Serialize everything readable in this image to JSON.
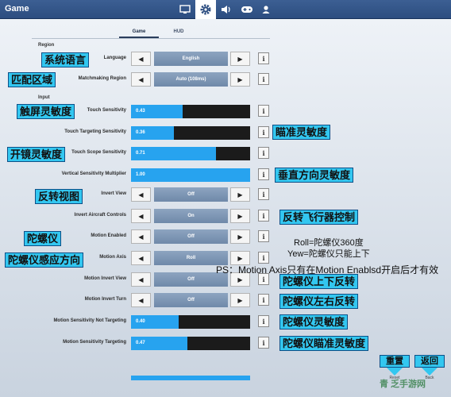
{
  "header": {
    "title": "Game",
    "icons": [
      {
        "name": "display-icon",
        "active": false
      },
      {
        "name": "gear-icon",
        "active": true
      },
      {
        "name": "speaker-icon",
        "active": false
      },
      {
        "name": "gamepad-icon",
        "active": false
      },
      {
        "name": "user-icon",
        "active": false
      }
    ]
  },
  "subtabs": [
    {
      "label": "Game",
      "active": true
    },
    {
      "label": "HUD",
      "active": false
    }
  ],
  "sections": {
    "region": "Region",
    "input": "Input"
  },
  "settings": [
    {
      "label": "Language",
      "type": "option",
      "value": "English"
    },
    {
      "label": "Matchmaking Region",
      "type": "option",
      "value": "Auto (108ms)"
    },
    {
      "label": "Touch Sensitivity",
      "type": "slider",
      "value": "0.43",
      "fill": 0.43
    },
    {
      "label": "Touch Targeting Sensitivity",
      "type": "slider",
      "value": "0.36",
      "fill": 0.36
    },
    {
      "label": "Touch Scope Sensitivity",
      "type": "slider",
      "value": "0.71",
      "fill": 0.71
    },
    {
      "label": "Vertical Sensitivity Multiplier",
      "type": "slider",
      "value": "1.00",
      "fill": 1.0
    },
    {
      "label": "Invert View",
      "type": "option",
      "value": "Off"
    },
    {
      "label": "Invert Aircraft Controls",
      "type": "option",
      "value": "On"
    },
    {
      "label": "Motion Enabled",
      "type": "option",
      "value": "Off"
    },
    {
      "label": "Motion Axis",
      "type": "option",
      "value": "Roll"
    },
    {
      "label": "Motion Invert View",
      "type": "option",
      "value": "Off"
    },
    {
      "label": "Motion Invert Turn",
      "type": "option",
      "value": "Off"
    },
    {
      "label": "Motion Sensitivity Not Targeting",
      "type": "slider",
      "value": "0.40",
      "fill": 0.4
    },
    {
      "label": "Motion Sensitivity Targeting",
      "type": "slider",
      "value": "0.47",
      "fill": 0.47
    }
  ],
  "annotations": {
    "language": "系统语言",
    "region": "匹配区域",
    "touch": "触屏灵敏度",
    "targeting": "瞄准灵敏度",
    "scope": "开镜灵敏度",
    "vertical": "垂直方向灵敏度",
    "invert_view": "反转视图",
    "aircraft": "反转飞行器控制",
    "gyro": "陀螺仪",
    "roll_line1": "Roll=陀螺仪360度",
    "roll_line2": "Yew=陀螺仪只能上下",
    "axis": "陀螺仪感应方向",
    "ps": "PS：Motion Axis只有在Motion Enablsd开启后才有效",
    "invert_updown": "陀螺仪上下反转",
    "invert_lr": "陀螺仪左右反转",
    "gyro_sens": "陀螺仪灵敏度",
    "gyro_aim": "陀螺仪瞄准灵敏度",
    "reset": "重置",
    "back": "返回"
  },
  "footer": {
    "reset_caption": "Reset",
    "back_caption": "Back"
  },
  "watermark": "青 乏手游网",
  "colors": {
    "accent": "#27a3ef",
    "note_bg": "#33c7f0",
    "header_bg": "#2c4d80"
  }
}
